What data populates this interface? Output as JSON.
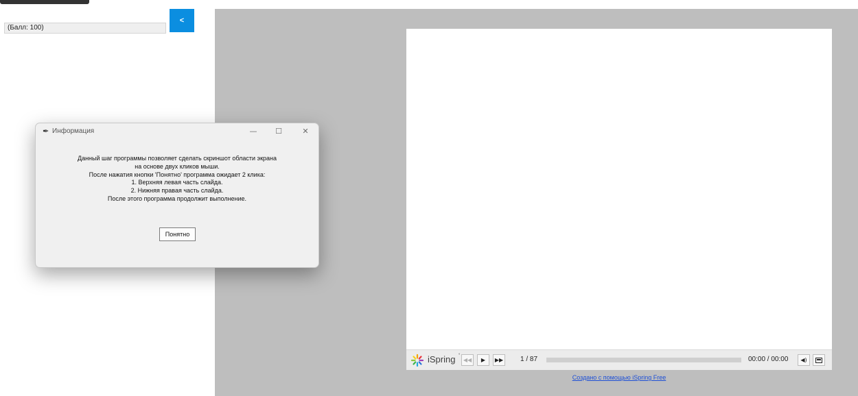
{
  "left_panel": {
    "score_text": "(Балл: 100)",
    "back_label": "<"
  },
  "player": {
    "logo_text": "iSpring",
    "logo_sup": "°",
    "slide_counter": "1 / 87",
    "time": "00:00 / 00:00",
    "footer_link": "Создано с помощью iSpring Free",
    "progress": 0
  },
  "dialog": {
    "title": "Информация",
    "lines": [
      "Данный шаг программы позволяет сделать скриншот области экрана",
      "на основе двух кликов мыши.",
      "После нажатия кнопки 'Понятно' программа ожидает 2 клика:",
      "1. Верхняя левая часть слайда.",
      "2. Нижняя правая часть слайда.",
      "После этого программа продолжит выполнение."
    ],
    "ok_label": "Понятно"
  },
  "colors": {
    "accent": "#0b8ee0",
    "stage_bg": "#bebebe",
    "link": "#1d4fd6"
  }
}
